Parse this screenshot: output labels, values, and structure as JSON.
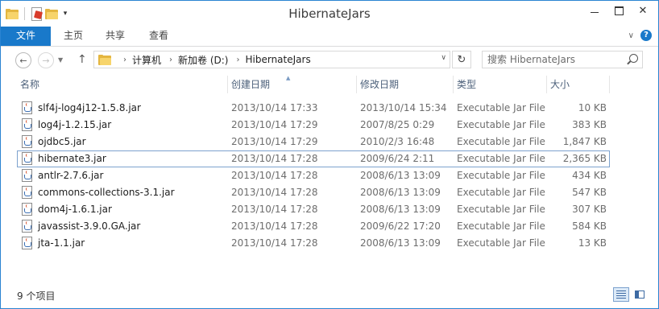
{
  "window": {
    "title": "HibernateJars"
  },
  "qat": {
    "icons": [
      "folder-icon",
      "properties-icon",
      "new-folder-icon",
      "customize-dropdown-icon"
    ]
  },
  "ribbon": {
    "tabs": [
      {
        "label": "文件",
        "active": true
      },
      {
        "label": "主页"
      },
      {
        "label": "共享"
      },
      {
        "label": "查看"
      }
    ],
    "help_label": "?"
  },
  "address": {
    "crumbs": [
      "计算机",
      "新加卷 (D:)",
      "HibernateJars"
    ]
  },
  "search": {
    "placeholder": "搜索 HibernateJars"
  },
  "columns": [
    "名称",
    "创建日期",
    "修改日期",
    "类型",
    "大小"
  ],
  "files": [
    {
      "name": "slf4j-log4j12-1.5.8.jar",
      "created": "2013/10/14 17:33",
      "modified": "2013/10/14 15:34",
      "type": "Executable Jar File",
      "size": "10 KB"
    },
    {
      "name": "log4j-1.2.15.jar",
      "created": "2013/10/14 17:29",
      "modified": "2007/8/25 0:29",
      "type": "Executable Jar File",
      "size": "383 KB"
    },
    {
      "name": "ojdbc5.jar",
      "created": "2013/10/14 17:29",
      "modified": "2010/2/3 16:48",
      "type": "Executable Jar File",
      "size": "1,847 KB"
    },
    {
      "name": "hibernate3.jar",
      "created": "2013/10/14 17:28",
      "modified": "2009/6/24 2:11",
      "type": "Executable Jar File",
      "size": "2,365 KB",
      "selected": true
    },
    {
      "name": "antlr-2.7.6.jar",
      "created": "2013/10/14 17:28",
      "modified": "2008/6/13 13:09",
      "type": "Executable Jar File",
      "size": "434 KB"
    },
    {
      "name": "commons-collections-3.1.jar",
      "created": "2013/10/14 17:28",
      "modified": "2008/6/13 13:09",
      "type": "Executable Jar File",
      "size": "547 KB"
    },
    {
      "name": "dom4j-1.6.1.jar",
      "created": "2013/10/14 17:28",
      "modified": "2008/6/13 13:09",
      "type": "Executable Jar File",
      "size": "307 KB"
    },
    {
      "name": "javassist-3.9.0.GA.jar",
      "created": "2013/10/14 17:28",
      "modified": "2009/6/22 17:20",
      "type": "Executable Jar File",
      "size": "584 KB"
    },
    {
      "name": "jta-1.1.jar",
      "created": "2013/10/14 17:28",
      "modified": "2008/6/13 13:09",
      "type": "Executable Jar File",
      "size": "13 KB"
    }
  ],
  "status": {
    "item_count": "9 个项目"
  },
  "colors": {
    "accent": "#1979ca",
    "selection_border": "#7da2ce",
    "header_text": "#4c607a"
  }
}
